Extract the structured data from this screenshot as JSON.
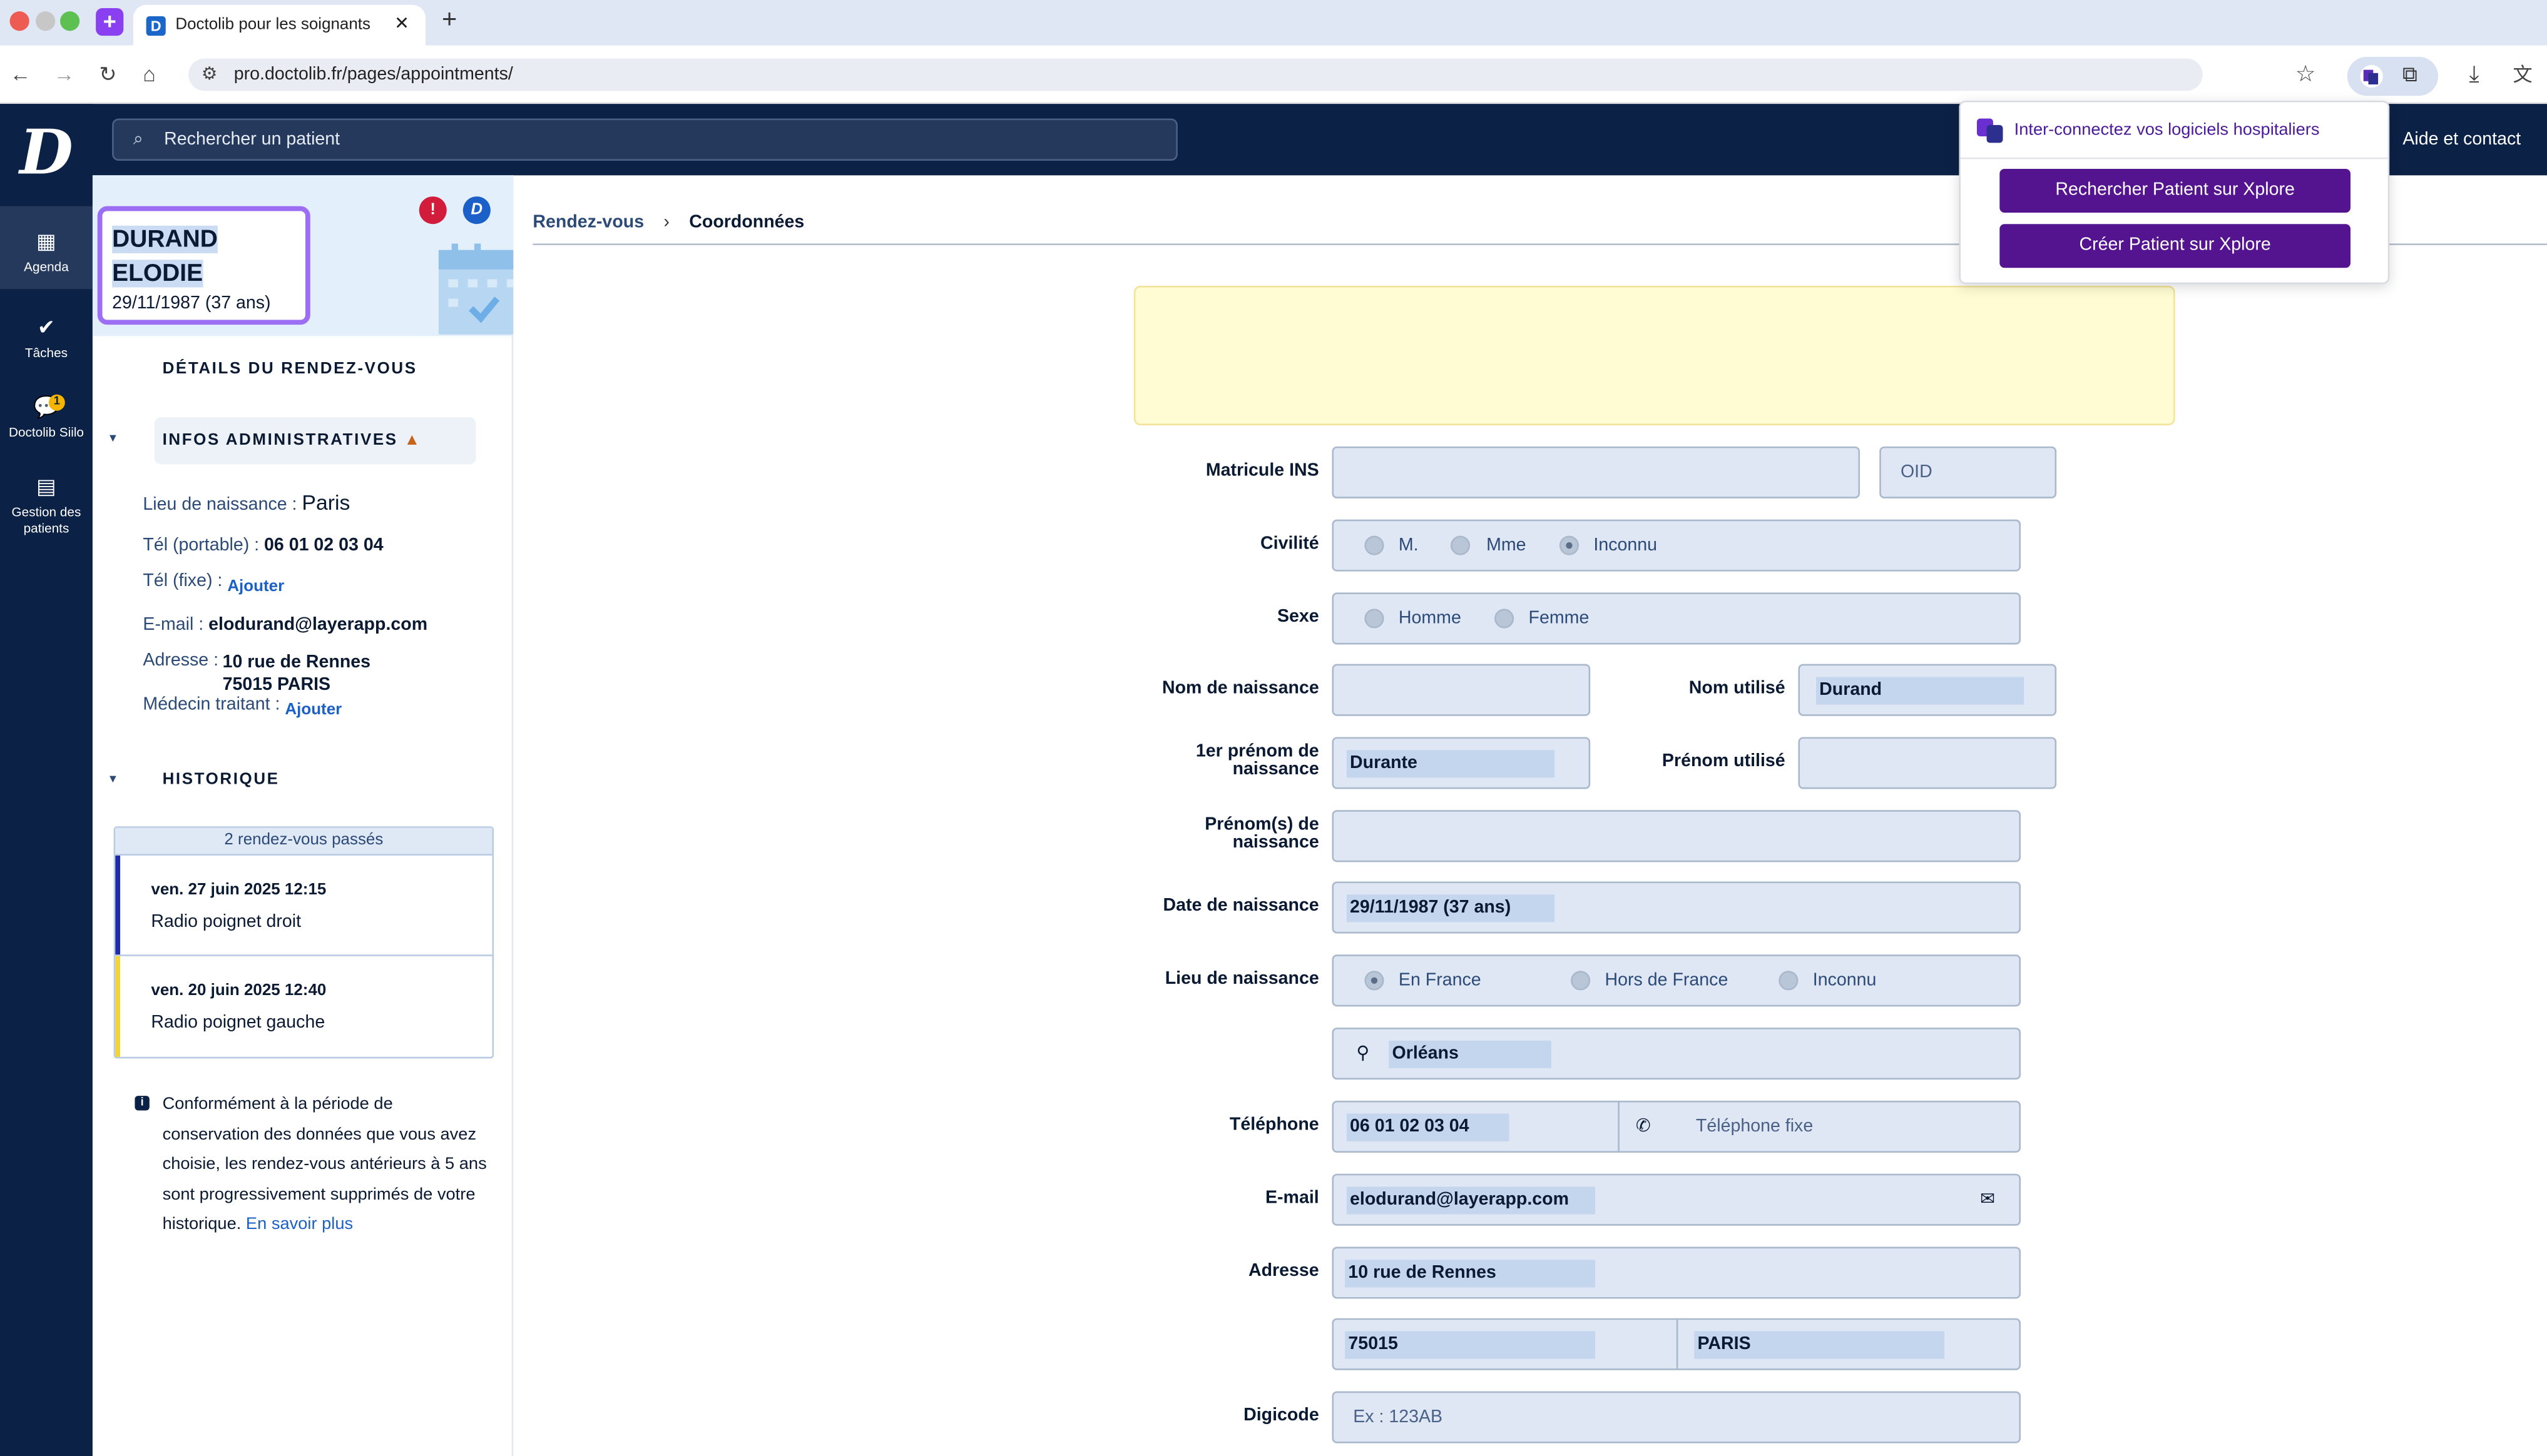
{
  "browser": {
    "tab_title": "Doctolib pour les soignants",
    "url": "pro.doctolib.fr/pages/appointments/",
    "tab_close": "✕",
    "new_tab": "+",
    "ext_icon": "+"
  },
  "header": {
    "logo": "D",
    "search_placeholder": "Rechercher un patient",
    "help": "Aide et contact"
  },
  "nav": [
    {
      "label": "Agenda",
      "icon": "calendar-icon"
    },
    {
      "label": "Tâches",
      "icon": "check-circle-icon"
    },
    {
      "label": "Doctolib Siilo",
      "icon": "chat-icon",
      "badge": "1"
    },
    {
      "label": "Gestion des patients",
      "icon": "clipboard-icon"
    }
  ],
  "patient": {
    "last_name": "DURAND",
    "first_name": "ELODIE",
    "dob": "29/11/1987 (37 ans)",
    "alert_icon": "!",
    "doctolib_icon": "D",
    "section_details": "DÉTAILS DU RENDEZ-VOUS",
    "section_admin": "INFOS ADMINISTRATIVES",
    "birthplace_label": "Lieu de naissance :",
    "birthplace": "Paris",
    "mobile_label": "Tél (portable) :",
    "mobile": "06 01 02 03 04",
    "landline_label": "Tél (fixe) :",
    "add": "Ajouter",
    "email_label": "E-mail :",
    "email": "elodurand@layerapp.com",
    "address_label": "Adresse :",
    "address_line1": "10 rue de Rennes",
    "address_line2": "75015 PARIS",
    "doctor_label": "Médecin traitant :",
    "history_title": "HISTORIQUE",
    "history_count": "2 rendez-vous passés",
    "appointments": [
      {
        "date": "ven. 27 juin 2025 12:15",
        "title": "Radio poignet droit",
        "color": "#1f2aa8"
      },
      {
        "date": "ven. 20 juin 2025 12:40",
        "title": "Radio poignet gauche",
        "color": "#f2d43a"
      }
    ],
    "note": "Conformément à la période de conservation des données que vous avez choisie, les rendez-vous antérieurs à 5 ans sont progressivement supprimés de votre historique.",
    "note_link": "En savoir plus",
    "note_icon": "i"
  },
  "breadcrumb": {
    "parent": "Rendez-vous",
    "separator": "›",
    "current": "Coordonnées"
  },
  "form": {
    "ins_label": "Matricule INS",
    "oid_placeholder": "OID",
    "civility_label": "Civilité",
    "civility_options": [
      "M.",
      "Mme",
      "Inconnu"
    ],
    "civility_selected": "Inconnu",
    "sex_label": "Sexe",
    "sex_options": [
      "Homme",
      "Femme"
    ],
    "birth_name_label": "Nom de naissance",
    "used_name_label": "Nom utilisé",
    "used_name": "Durand",
    "first_name_label": "1er prénom de naissance",
    "first_name": "Durante",
    "used_first_name_label": "Prénom utilisé",
    "first_names_label": "Prénom(s) de naissance",
    "dob_label": "Date de naissance",
    "dob": "29/11/1987 (37 ans)",
    "birthplace_label": "Lieu de naissance",
    "birthplace_options": [
      "En France",
      "Hors de France",
      "Inconnu"
    ],
    "birthplace_selected": "En France",
    "city": "Orléans",
    "phone_label": "Téléphone",
    "mobile": "06 01 02 03 04",
    "landline_placeholder": "Téléphone fixe",
    "email_label": "E-mail",
    "email": "elodurand@layerapp.com",
    "address_label": "Adresse",
    "address": "10 rue de Rennes",
    "zip": "75015",
    "city2": "PARIS",
    "digicode_label": "Digicode",
    "digicode_placeholder": "Ex : 123AB"
  },
  "popup": {
    "title": "Inter-connectez vos logiciels hospitaliers",
    "search_button": "Rechercher Patient sur Xplore",
    "create_button": "Créer Patient sur Xplore"
  },
  "colors": {
    "navy": "#0b2145",
    "accent": "#54138f",
    "highlight": "#9b6ef3"
  }
}
